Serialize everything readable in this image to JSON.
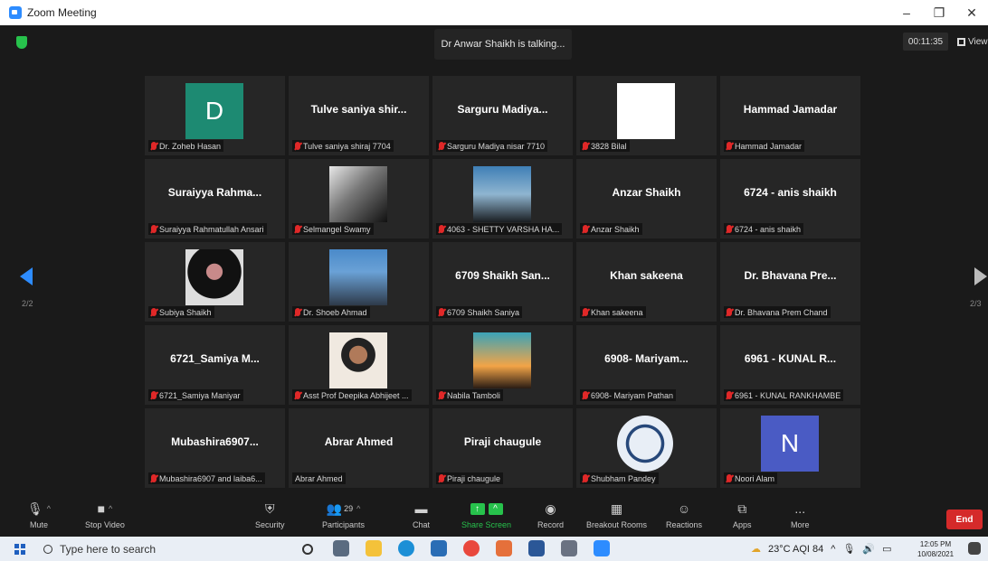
{
  "window": {
    "title": "Zoom Meeting",
    "minimize": "–",
    "maximize": "❐",
    "close": "✕"
  },
  "meeting": {
    "talking_indicator": "Dr Anwar Shaikh is talking...",
    "timer": "00:11:35",
    "view_label": "View",
    "page_left": "2/2",
    "page_right": "2/3"
  },
  "tiles": [
    {
      "big": "",
      "label": "Dr. Zoheb Hasan",
      "avatar": "D",
      "avatar_color": "#1d8a72"
    },
    {
      "big": "Tulve saniya shir...",
      "label": "Tulve saniya shiraj 7704"
    },
    {
      "big": "Sarguru Madiya...",
      "label": "Sarguru Madiya nisar 7710"
    },
    {
      "big": "",
      "label": "3828 Bilal",
      "photo": "white"
    },
    {
      "big": "Hammad Jamadar",
      "label": "Hammad Jamadar"
    },
    {
      "big": "Suraiyya Rahma...",
      "label": "Suraiyya Rahmatullah Ansari"
    },
    {
      "big": "",
      "label": "Selmangel Swamy",
      "photo": "bw"
    },
    {
      "big": "",
      "label": "4063 - SHETTY VARSHA HA...",
      "photo": "sunset"
    },
    {
      "big": "Anzar Shaikh",
      "label": "Anzar Shaikh"
    },
    {
      "big": "6724 - anis shaikh",
      "label": "6724 - anis shaikh"
    },
    {
      "big": "",
      "label": "Subiya Shaikh",
      "photo": "hijab"
    },
    {
      "big": "",
      "label": "Dr. Shoeb Ahmad",
      "photo": "portrait"
    },
    {
      "big": "6709 Shaikh San...",
      "label": "6709 Shaikh Saniya"
    },
    {
      "big": "Khan sakeena",
      "label": "Khan sakeena"
    },
    {
      "big": "Dr. Bhavana Pre...",
      "label": "Dr. Bhavana Prem Chand"
    },
    {
      "big": "6721_Samiya M...",
      "label": "6721_Samiya Maniyar"
    },
    {
      "big": "",
      "label": "Asst Prof Deepika Abhijeet ...",
      "photo": "woman"
    },
    {
      "big": "",
      "label": "Nabila Tamboli",
      "photo": "dusk"
    },
    {
      "big": "6908- Mariyam...",
      "label": "6908- Mariyam Pathan"
    },
    {
      "big": "6961 - KUNAL R...",
      "label": "6961 - KUNAL RANKHAMBE"
    },
    {
      "big": "Mubashira6907...",
      "label": "Mubashira6907 and laiba6..."
    },
    {
      "big": "Abrar Ahmed",
      "label": "Abrar Ahmed",
      "unmuted": true
    },
    {
      "big": "Piraji chaugule",
      "label": "Piraji chaugule"
    },
    {
      "big": "",
      "label": "Shubham Pandey",
      "photo": "logo"
    },
    {
      "big": "",
      "label": "Noori Alam",
      "avatar": "N",
      "avatar_color": "#4a5bc4"
    }
  ],
  "toolbar": {
    "mute": "Mute",
    "stop_video": "Stop Video",
    "security": "Security",
    "participants": "Participants",
    "participants_count": "29",
    "chat": "Chat",
    "share_screen": "Share Screen",
    "record": "Record",
    "breakout_rooms": "Breakout Rooms",
    "reactions": "Reactions",
    "apps": "Apps",
    "more": "More",
    "more_dots": "...",
    "end": "End"
  },
  "taskbar": {
    "search_placeholder": "Type here to search",
    "weather": "23°C AQI 84",
    "time": "12:05 PM",
    "date": "10/08/2021"
  },
  "colors": {
    "accent": "#2d8cff",
    "share_green": "#27c24c",
    "end_red": "#d52a2a"
  }
}
